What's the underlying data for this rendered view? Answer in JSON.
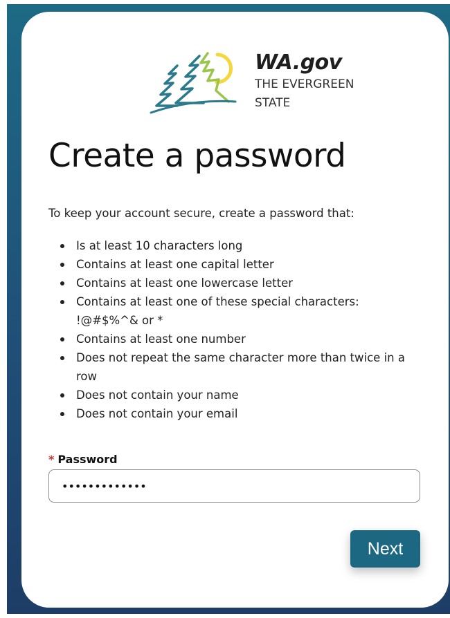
{
  "logo": {
    "brand": "WA.gov",
    "tagline_line1": "THE EVERGREEN",
    "tagline_line2": "STATE",
    "icon": "evergreen-trees-sun-logo"
  },
  "page_title": "Create a password",
  "intro": "To keep your account secure, create a password that:",
  "rules": [
    "Is at least 10 characters long",
    "Contains at least one capital letter",
    "Contains at least one lowercase letter",
    "Contains at least one of these special characters: !@#$%^& or *",
    "Contains at least one number",
    "Does not repeat the same character more than twice in a row",
    "Does not contain your name",
    "Does not contain your email"
  ],
  "password_field": {
    "required_marker": "*",
    "label": "Password",
    "value": "•••••••••••••"
  },
  "next_button": "Next",
  "colors": {
    "background_gradient_top": "#1d6a85",
    "background_gradient_bottom": "#1d3d66",
    "button": "#1c6782",
    "required": "#c23934",
    "logo_teal": "#2b7a8c",
    "logo_green": "#9ac54a",
    "logo_yellow": "#f5d63d"
  }
}
